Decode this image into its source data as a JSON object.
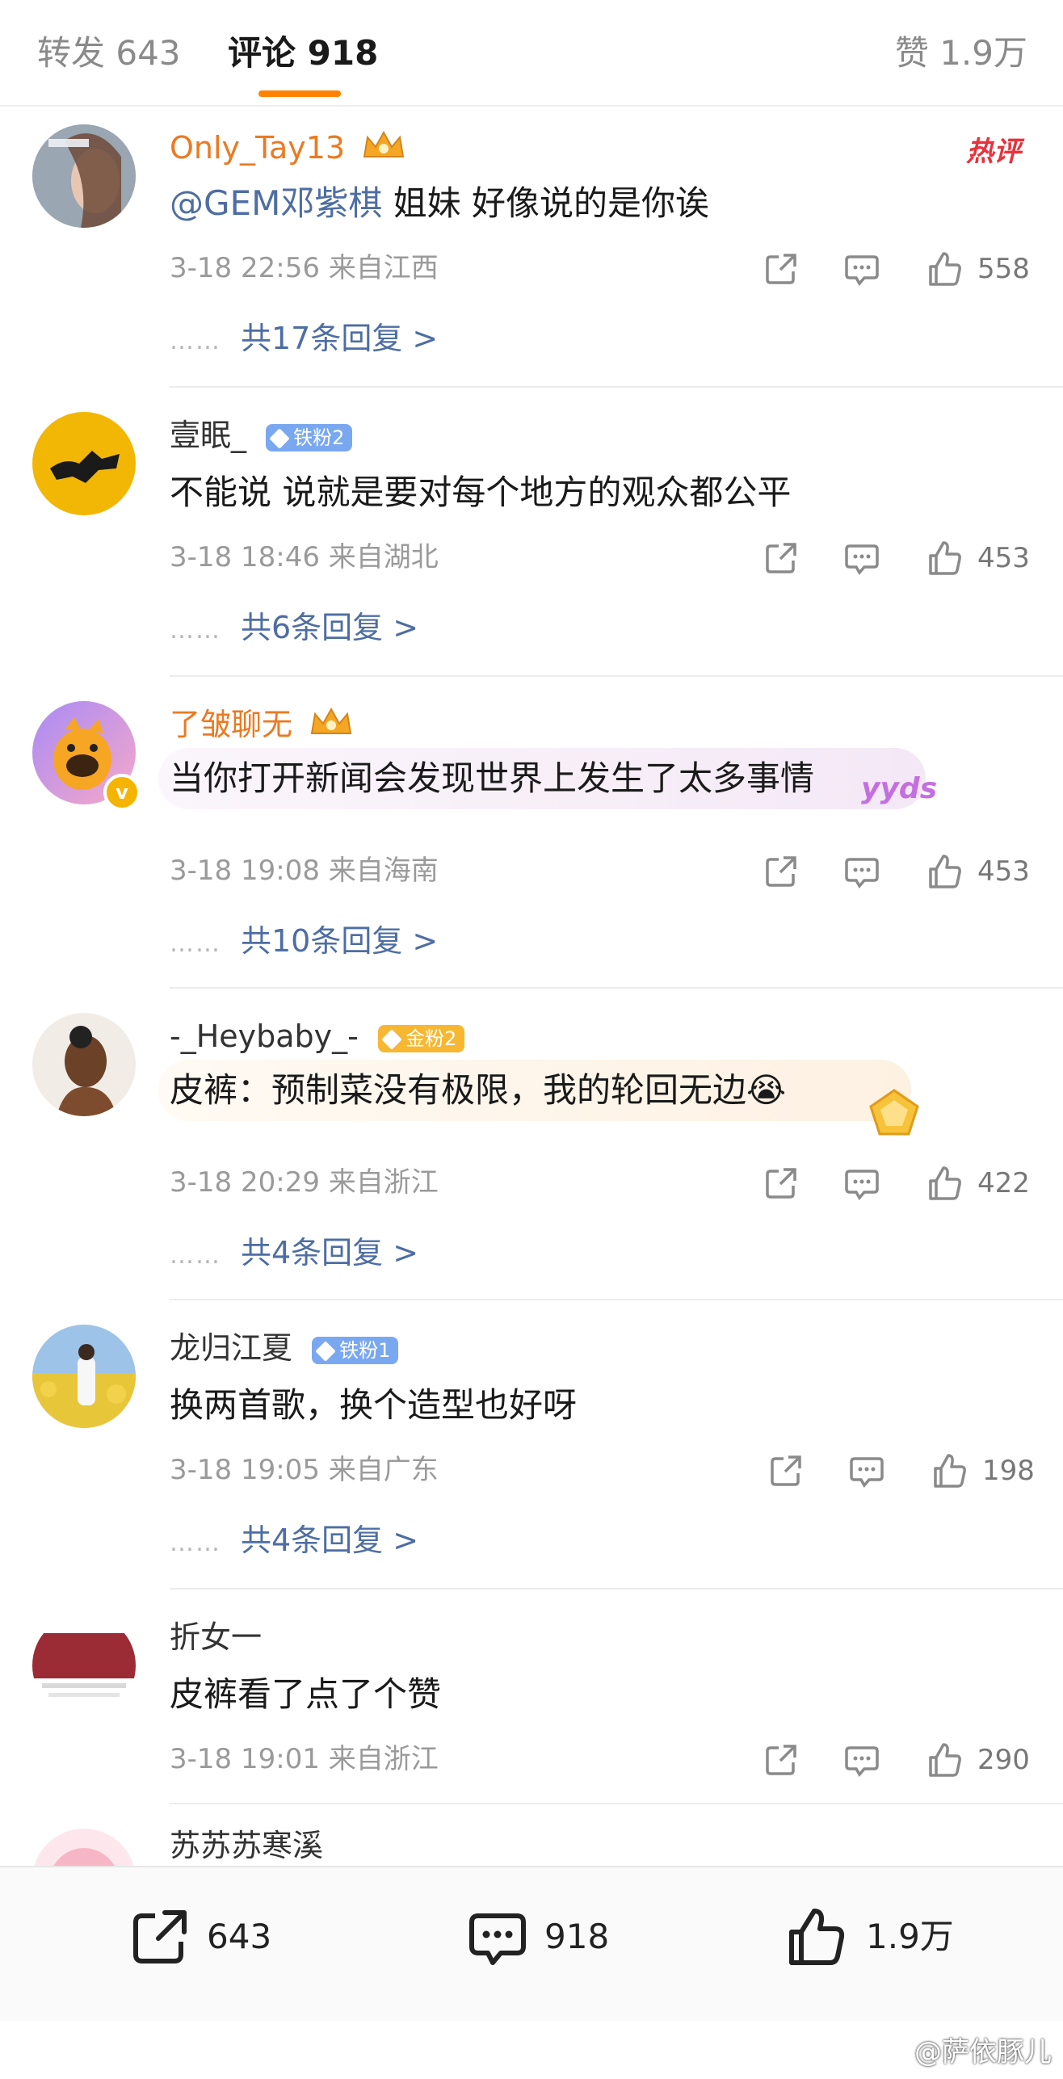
{
  "tabs": {
    "repost": "转发 643",
    "comment": "评论 918",
    "like": "赞 1.9万"
  },
  "hot_label": "热评",
  "comments": [
    {
      "name": "Only_Tay13",
      "mention": "@GEM邓紫棋",
      "text": " 姐妹 好像说的是你诶",
      "meta": "3-18 22:56  来自江西",
      "likes": "558",
      "replies": "共17条回复 >"
    },
    {
      "name": "壹眠_",
      "badge": "铁粉2",
      "text": "不能说 说就是要对每个地方的观众都公平",
      "meta": "3-18 18:46  来自湖北",
      "likes": "453",
      "replies": "共6条回复 >"
    },
    {
      "name": "了皱聊无",
      "verified": "v",
      "text": "当你打开新闻会发现世界上发生了太多事情",
      "bubble_tag": "yyds",
      "meta": "3-18 19:08  来自海南",
      "likes": "453",
      "replies": "共10条回复 >"
    },
    {
      "name": "-_Heybaby_-",
      "badge": "金粉2",
      "text": "皮裤：预制菜没有极限，我的轮回无边",
      "emoji": "😭",
      "meta": "3-18 20:29  来自浙江",
      "likes": "422",
      "replies": "共4条回复 >"
    },
    {
      "name": "龙归江夏",
      "badge": "铁粉1",
      "text": "换两首歌，换个造型也好呀",
      "meta": "3-18 19:05  来自广东",
      "likes": "198",
      "replies": "共4条回复 >"
    },
    {
      "name": "折女一",
      "text": "皮裤看了点了个赞",
      "meta": "3-18 19:01  来自浙江",
      "likes": "290"
    },
    {
      "name": "苏苏苏寒溪"
    }
  ],
  "reply_dots": "……",
  "bottom": {
    "repost_count": "643",
    "comment_count": "918",
    "like_count": "1.9万"
  },
  "watermark": "@萨依豚儿",
  "icons": {
    "share": "share-icon",
    "comment": "comment-icon",
    "like": "thumbs-up-icon",
    "crown": "crown-icon"
  },
  "colors": {
    "accent": "#ff8200",
    "link": "#4e6ea3",
    "vip_name": "#eb7a22",
    "hot": "#e8323c"
  }
}
